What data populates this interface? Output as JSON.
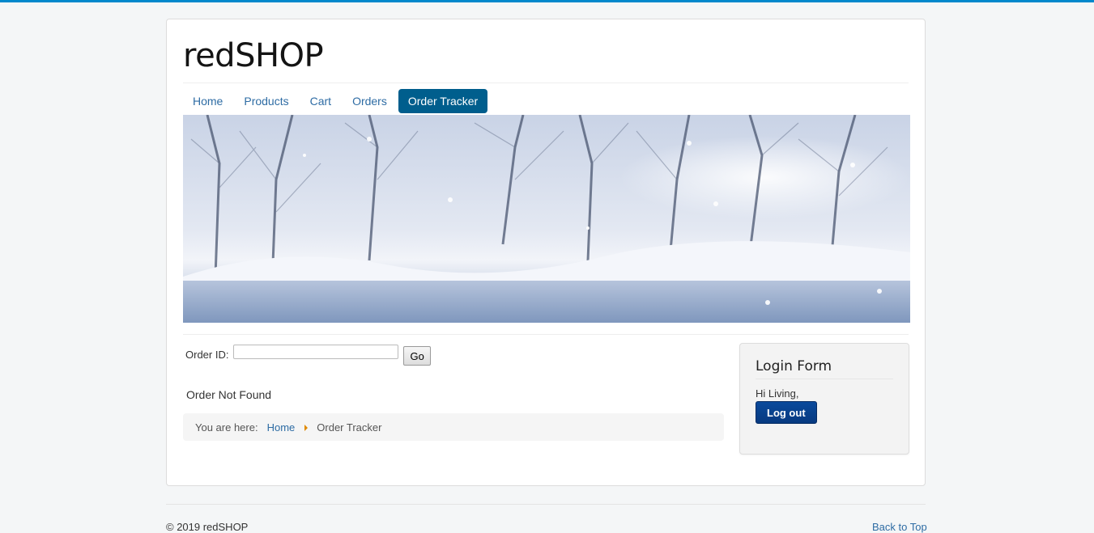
{
  "site": {
    "brand": "redSHOP"
  },
  "nav": {
    "items": [
      {
        "label": "Home"
      },
      {
        "label": "Products"
      },
      {
        "label": "Cart"
      },
      {
        "label": "Orders"
      },
      {
        "label": "Order Tracker",
        "active": true
      }
    ]
  },
  "order_form": {
    "label": "Order ID:",
    "input_value": "",
    "go_label": "Go"
  },
  "status": {
    "message": "Order Not Found"
  },
  "breadcrumb": {
    "prefix": "You are here:",
    "home": "Home",
    "current": "Order Tracker"
  },
  "login": {
    "title": "Login Form",
    "greeting": "Hi Living,",
    "logout_label": "Log out"
  },
  "footer": {
    "copyright": "© 2019 redSHOP",
    "back_to_top": "Back to Top"
  },
  "colors": {
    "top_bar": "#0088cc",
    "nav_active": "#005e8d",
    "link": "#2e6ca4",
    "logout_button": "#0a4a9c"
  }
}
